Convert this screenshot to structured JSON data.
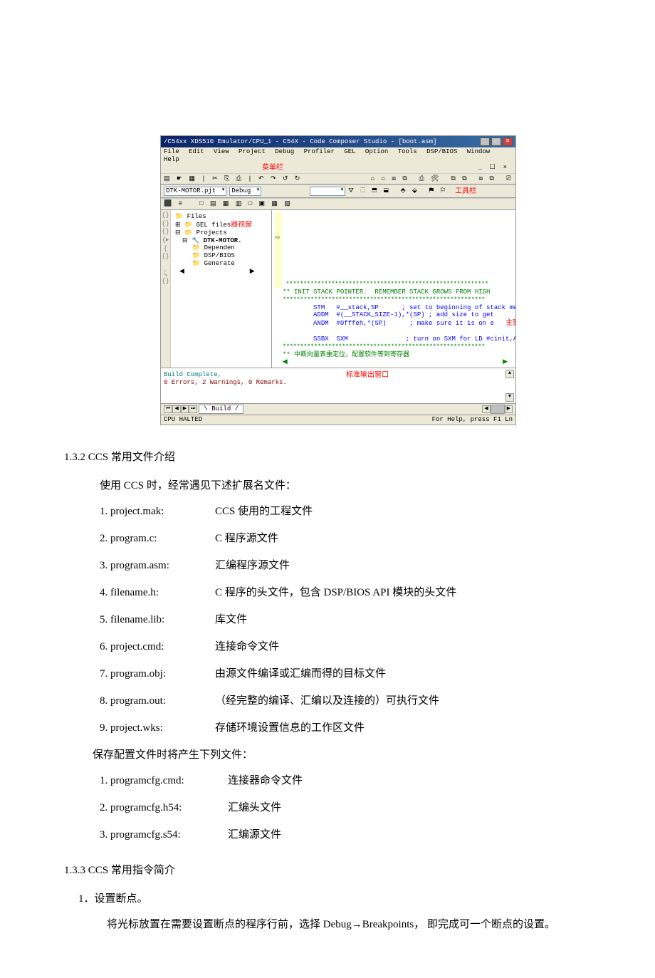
{
  "screenshot": {
    "title": "/C54xx XDS510 Emulator/CPU_1 - C54X - Code Composer Studio - [boot.asm]",
    "menus": [
      "File",
      "Edit",
      "View",
      "Project",
      "Debug",
      "Profiler",
      "GEL",
      "Option",
      "Tools",
      "DSP/BIOS",
      "Window",
      "Help"
    ],
    "menu_anno": "菜单栏",
    "project_combo": "DTK-MOTOR.pjt",
    "config_combo": "Debug",
    "toolbar_anno": "工具栏",
    "tree": {
      "root": "Files",
      "gel": "GEL files",
      "gel_anno": "器视窗",
      "projects": "Projects",
      "project": "DTK-MOTOR.",
      "sub1": "Dependen",
      "sub2": "DSP/BIOS",
      "sub3": "Generate"
    },
    "code_anno_main": "主窗口",
    "code_line1": "** INIT STACK POINTER.  REMEMBER STACK GROWS FROM HIGH",
    "code_stm": "STM   #__stack,SP      ; set to beginning of stack me",
    "code_addm1": "ADDM  #(__STACK_SIZE-1),*(SP) ; add size to get",
    "code_andm": "ANDM  #0fffeh,*(SP)      ; make sure it is on e",
    "code_ssbx": "SSBX  SXM               ; turn on SXM for LD #cinit,A",
    "code_comment_cn": "** 中断向量表重定位，配置软件等到寄存器",
    "output_build": "Build Complete,",
    "output_err": "  0 Errors, 2 Warnings, 0 Remarks.",
    "output_anno": "标准输出窗口",
    "tab": "Build",
    "status_left": "CPU HALTED",
    "status_right": "For Help, press F1      Ln"
  },
  "sec132_title": "1.3.2 CCS 常用文件介绍",
  "sec132_intro": "使用 CCS 时，经常遇见下述扩展名文件：",
  "files1": [
    {
      "n": "1. project.mak:",
      "d": "CCS 使用的工程文件"
    },
    {
      "n": "2. program.c:",
      "d": "C 程序源文件"
    },
    {
      "n": "3. program.asm:",
      "d": "汇编程序源文件"
    },
    {
      "n": "4. filename.h:",
      "d": "C 程序的头文件，包含 DSP/BIOS API 模块的头文件"
    },
    {
      "n": "5. filename.lib:",
      "d": "库文件"
    },
    {
      "n": "6. project.cmd:",
      "d": "连接命令文件"
    },
    {
      "n": "7. program.obj:",
      "d": "由源文件编译或汇编而得的目标文件"
    },
    {
      "n": "8. program.out:",
      "d": "（经完整的编译、汇编以及连接的）可执行文件"
    },
    {
      "n": "9. project.wks:",
      "d": "存储环境设置信息的工作区文件"
    }
  ],
  "save_note": "保存配置文件时将产生下列文件：",
  "files2": [
    {
      "n": "1. programcfg.cmd:",
      "d": "连接器命令文件"
    },
    {
      "n": "2. programcfg.h54:",
      "d": "汇编头文件"
    },
    {
      "n": "3. programcfg.s54:",
      "d": "汇编源文件"
    }
  ],
  "sec133_title": "1.3.3 CCS 常用指令简介",
  "item1_title": "1．设置断点。",
  "item1_body": "将光标放置在需要设置断点的程序行前，选择 Debug→Breakpoints， 即完成可一个断点的设置。"
}
